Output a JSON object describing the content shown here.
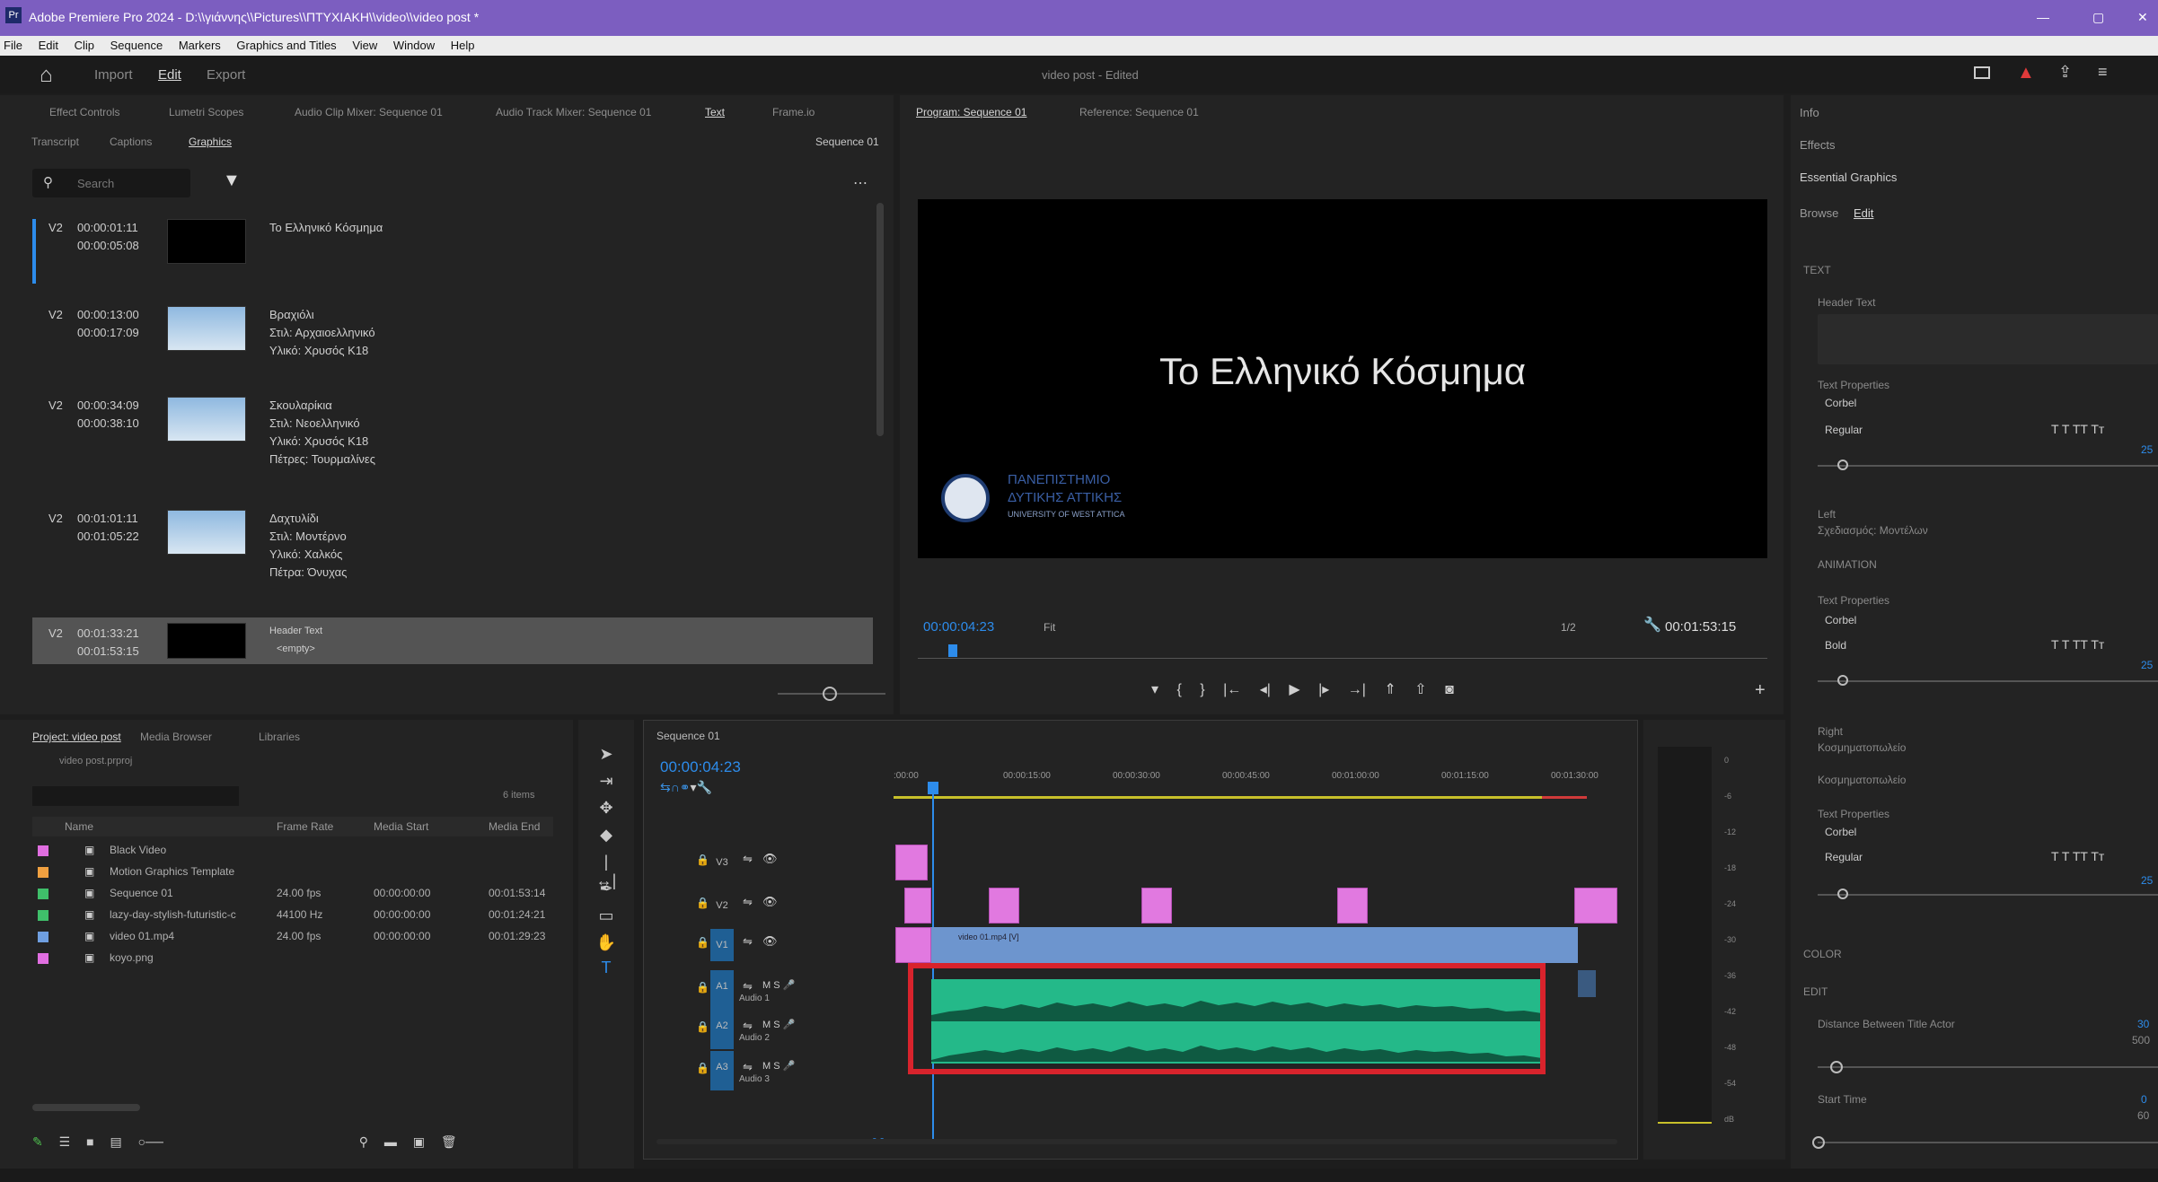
{
  "window": {
    "title": "Adobe Premiere Pro 2024 - D:\\\\γιάννης\\\\Pictures\\\\ΠΤΥΧΙΑΚΗ\\\\video\\\\video post *",
    "controls": [
      "—",
      "▢",
      "✕"
    ]
  },
  "menu": [
    "File",
    "Edit",
    "Clip",
    "Sequence",
    "Markers",
    "Graphics and Titles",
    "View",
    "Window",
    "Help"
  ],
  "workspace": {
    "home": "⌂",
    "tabs": [
      "Import",
      "Edit",
      "Export"
    ],
    "project_title": "video post - Edited"
  },
  "source_tabs": [
    "Effect Controls",
    "Lumetri Scopes",
    "Audio Clip Mixer: Sequence 01",
    "Audio Track Mixer: Sequence 01",
    "Text",
    "Frame.io"
  ],
  "text_panel": {
    "subtabs": [
      "Transcript",
      "Captions",
      "Graphics"
    ],
    "sequence_label": "Sequence 01",
    "search_placeholder": "Search",
    "items": [
      {
        "track": "V2",
        "in": "00:00:01:11",
        "out": "00:00:05:08",
        "lines": [
          "Το Ελληνικό Κόσμημα"
        ]
      },
      {
        "track": "V2",
        "in": "00:00:13:00",
        "out": "00:00:17:09",
        "lines": [
          "Βραχιόλι",
          "Στιλ: Αρχαιοελληνικό",
          "Υλικό: Χρυσός Κ18"
        ]
      },
      {
        "track": "V2",
        "in": "00:00:34:09",
        "out": "00:00:38:10",
        "lines": [
          "Σκουλαρίκια",
          "Στιλ: Νεοελληνικό",
          "Υλικό: Χρυσός Κ18",
          "Πέτρες: Τουρμαλίνες"
        ]
      },
      {
        "track": "V2",
        "in": "00:01:01:11",
        "out": "00:01:05:22",
        "lines": [
          "Δαχτυλίδι",
          "Στιλ: Μοντέρνο",
          "Υλικό: Χαλκός",
          "Πέτρα: Όνυχας"
        ]
      },
      {
        "track": "V2",
        "in": "00:01:33:21",
        "out": "00:01:53:15",
        "lines": [
          "Header Text",
          "<empty>"
        ]
      }
    ]
  },
  "program": {
    "tabs": [
      "Program: Sequence 01",
      "Reference: Sequence 01"
    ],
    "title_text": "Το Ελληνικό Κόσμημα",
    "logo_lines": [
      "ΠΑΝΕΠΙΣΤΗΜΙΟ",
      "ΔΥΤΙΚΗΣ ΑΤΤΙΚΗΣ",
      "UNIVERSITY OF WEST ATTICA"
    ],
    "timecode": "00:00:04:23",
    "fit": "Fit",
    "resolution": "1/2",
    "duration": "00:01:53:15"
  },
  "project": {
    "tabs": [
      "Project: video post",
      "Media Browser",
      "Libraries"
    ],
    "file": "video post.prproj",
    "count": "6 items",
    "headers": [
      "Name",
      "Frame Rate",
      "Media Start",
      "Media End"
    ],
    "rows": [
      {
        "color": "#e06ee0",
        "name": "Black Video",
        "fps": "",
        "start": "",
        "end": ""
      },
      {
        "color": "#f0a040",
        "name": "Motion Graphics Template",
        "fps": "",
        "start": "",
        "end": ""
      },
      {
        "color": "#3fbf6a",
        "name": "Sequence 01",
        "fps": "24.00 fps",
        "start": "00:00:00:00",
        "end": "00:01:53:14"
      },
      {
        "color": "#3fbf6a",
        "name": "lazy-day-stylish-futuristic-c",
        "fps": "44100 Hz",
        "start": "00:00:00:00",
        "end": "00:01:24:21"
      },
      {
        "color": "#6f9fe0",
        "name": "video 01.mp4",
        "fps": "24.00 fps",
        "start": "00:00:00:00",
        "end": "00:01:29:23"
      },
      {
        "color": "#e06ee0",
        "name": "koyo.png",
        "fps": "",
        "start": "",
        "end": ""
      }
    ]
  },
  "timeline": {
    "tab": "Sequence 01",
    "timecode": "00:00:04:23",
    "ruler": [
      ":00:00",
      "00:00:15:00",
      "00:00:30:00",
      "00:00:45:00",
      "00:01:00:00",
      "00:01:15:00",
      "00:01:30:00"
    ],
    "tracks": [
      "V3",
      "V2",
      "V1",
      "A1",
      "A2",
      "A3"
    ],
    "audio_names": [
      "Audio 1",
      "Audio 2",
      "Audio 3"
    ],
    "clip_label": "video 01.mp4 [V]",
    "master": "0.0"
  },
  "essential_graphics": {
    "top_tabs": [
      "Info",
      "Effects",
      "Essential Graphics"
    ],
    "subtabs": [
      "Browse",
      "Edit"
    ],
    "sections": [
      "TEXT",
      "Header Text",
      "Text Properties",
      "Corbel",
      "Regular",
      "Left",
      "Σχεδιασμός: Μοντέλων",
      "ANIMATION",
      "Text Properties",
      "Corbel",
      "Bold",
      "Right",
      "Κοσμηματοπωλείο",
      "Κοσμηματοπωλείο",
      "Text Properties",
      "Corbel",
      "Regular",
      "COLOR",
      "EDIT",
      "Distance Between Title Actor",
      "Start Time"
    ],
    "values": [
      "25",
      "25",
      "25",
      "30",
      "500",
      "0",
      "60"
    ]
  },
  "meter_labels": [
    "0",
    "-6",
    "-12",
    "-18",
    "-24",
    "-30",
    "-36",
    "-42",
    "-48",
    "-54",
    "dB"
  ]
}
